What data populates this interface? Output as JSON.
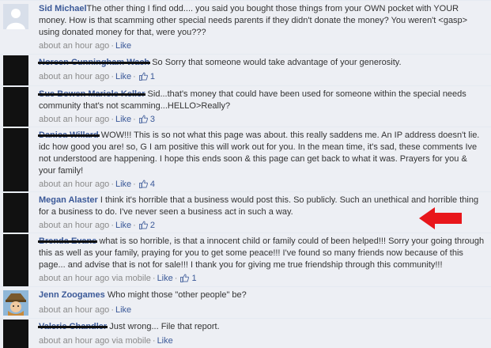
{
  "comments": [
    {
      "author": "Sid Michael",
      "text": "The other thing I find odd.... you said you bought those things from your OWN pocket with YOUR money. How is that scamming other special needs parents if they didn't donate the money? You weren't <gasp> using donated money for that, were you???",
      "time": "about an hour ago",
      "like": "Like"
    },
    {
      "author": "Noreen Cunningham Wach",
      "text": "So Sorry that someone would take advantage of your generosity.",
      "time": "about an hour ago",
      "like": "Like",
      "likes": "1"
    },
    {
      "author": "Sue Bowen Mariole Keller",
      "text": "Sid...that's money that could have been used for someone within the special needs community that's not scamming...HELLO>Really?",
      "time": "about an hour ago",
      "like": "Like",
      "likes": "3"
    },
    {
      "author": "Danica Willard",
      "text": "WOW!!! This is so not what this page was about. this really saddens me. An IP address doesn't lie. idc how good you are! so, G I am positive this will work out for you. In the mean time, it's sad, these comments Ive not understood are happening. I hope this ends soon & this page can get back to what it was. Prayers for you & your family!",
      "time": "about an hour ago",
      "like": "Like",
      "likes": "4"
    },
    {
      "author": "Megan Alaster",
      "text": "I think it's horrible that a business would post this. So publicly. Such an unethical and horrible thing for a business to do. I've never seen a business act in such a way.",
      "time": "about an hour ago",
      "like": "Like",
      "likes": "2"
    },
    {
      "author": "Brenda Evans",
      "text": "what is so horrible, is that a innocent child or family could of been helped!!! Sorry your going through this as well as your family, praying for you to get some peace!!! I've found so many friends now because of this page... and advise that is not for sale!!! I thank you for giving me true friendship through this community!!!",
      "time": "about an hour ago via mobile",
      "like": "Like",
      "likes": "1"
    },
    {
      "author": "Jenn Zoogames",
      "text": "Who might those \"other people\" be?",
      "time": "about an hour ago",
      "like": "Like"
    },
    {
      "author": "Valerie Chandler",
      "text": "Just wrong... File that report.",
      "time": "about an hour ago via mobile",
      "like": "Like"
    }
  ],
  "colors": {
    "author": "#3b5998",
    "comment_bg": "#edeff4",
    "annotation_arrow": "#e8161b"
  }
}
